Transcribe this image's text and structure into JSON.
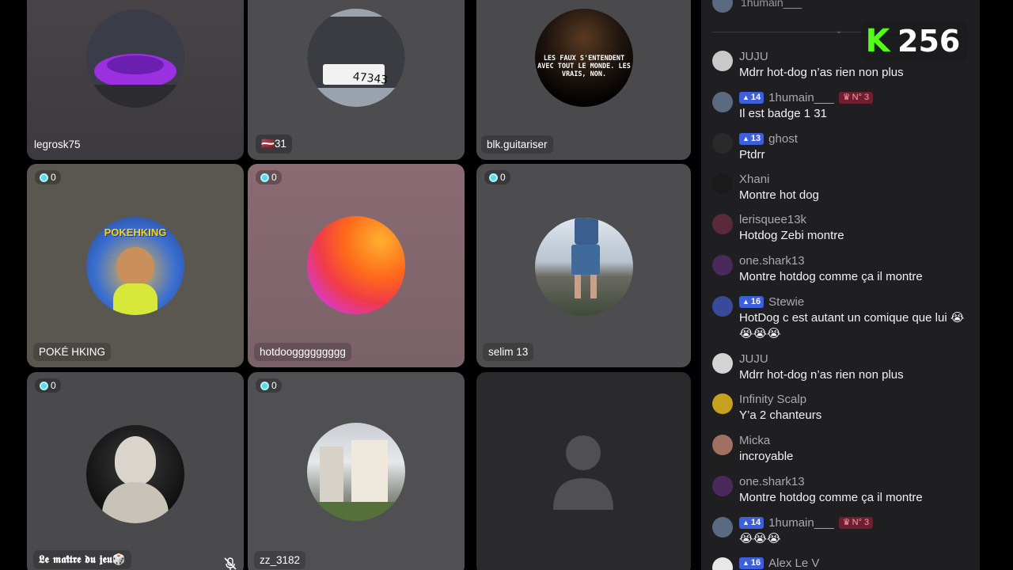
{
  "tiles": [
    {
      "name": "legrosk75",
      "score": null
    },
    {
      "name": "31",
      "flag": "🇱🇻",
      "score": null
    },
    {
      "name": "blk.guitariser",
      "score": null,
      "poster_text": "LES FAUX S'ENTENDENT AVEC TOUT LE MONDE. LES VRAIS, NON."
    },
    {
      "name": "POKÉ HKING",
      "score": "0",
      "poster_text": "POKEHKING"
    },
    {
      "name": "hotdooggggggggg",
      "score": "0"
    },
    {
      "name": "selim 13",
      "score": "0"
    },
    {
      "name": "𝕷𝖊 𝖒𝖆𝖎̂𝖙𝖗𝖊 𝖉𝖚 𝖏𝖊𝖚🎲",
      "score": "0",
      "mic_muted": true
    },
    {
      "name": "zz_3182",
      "score": "0"
    },
    {
      "name": "",
      "score": null,
      "empty": true
    }
  ],
  "kick_counter": {
    "logo": "K",
    "value": "256"
  },
  "chat": {
    "top_user": "1humain___",
    "messages": [
      {
        "user": "JUJU",
        "text": "Mdrr hot-dog n’as rien non plus",
        "avatar": "#c9c9c9"
      },
      {
        "user": "1humain___",
        "level": "14",
        "rank": "N° 3",
        "text": "Il est badge 1 31",
        "avatar": "#5a6a80"
      },
      {
        "user": "ghost",
        "level": "13",
        "text": "Ptdrr",
        "avatar": "#2a2a2a"
      },
      {
        "user": "Xhani",
        "text": "Montre hot dog",
        "avatar": "#1a1a1a"
      },
      {
        "user": "lerisquee13k",
        "text": "Hotdog Zebi montre",
        "avatar": "#5a2a3a"
      },
      {
        "user": "one.shark13",
        "text": "Montre hotdog comme ça il montre",
        "avatar": "#4a2a5a"
      },
      {
        "user": "Stewie",
        "level": "16",
        "text": "HotDog c est autant un comique que lui 😭😭😭😭",
        "avatar": "#3a4a9a"
      },
      {
        "user": "JUJU",
        "text": "Mdrr hot-dog n’as rien non plus",
        "avatar": "#d4d4d4"
      },
      {
        "user": "Infinity Scalp",
        "text": "Y’a 2 chanteurs",
        "avatar": "#c8a020"
      },
      {
        "user": "Micka",
        "text": "incroyable",
        "avatar": "#a07060"
      },
      {
        "user": "one.shark13",
        "text": "Montre hotdog comme ça il montre",
        "avatar": "#4a2a5a"
      },
      {
        "user": "1humain___",
        "level": "14",
        "rank": "N° 3",
        "text": "😭😭😭",
        "avatar": "#5a6a80"
      },
      {
        "user": "Alex Le V",
        "level": "16",
        "text": "",
        "avatar": "#e8e8e8"
      }
    ]
  },
  "colors": {
    "accent": "#53fc18",
    "level_badge": "#3d5fd9",
    "rank_badge": "#6e1f2e",
    "chat_bg": "#1f1f21"
  }
}
